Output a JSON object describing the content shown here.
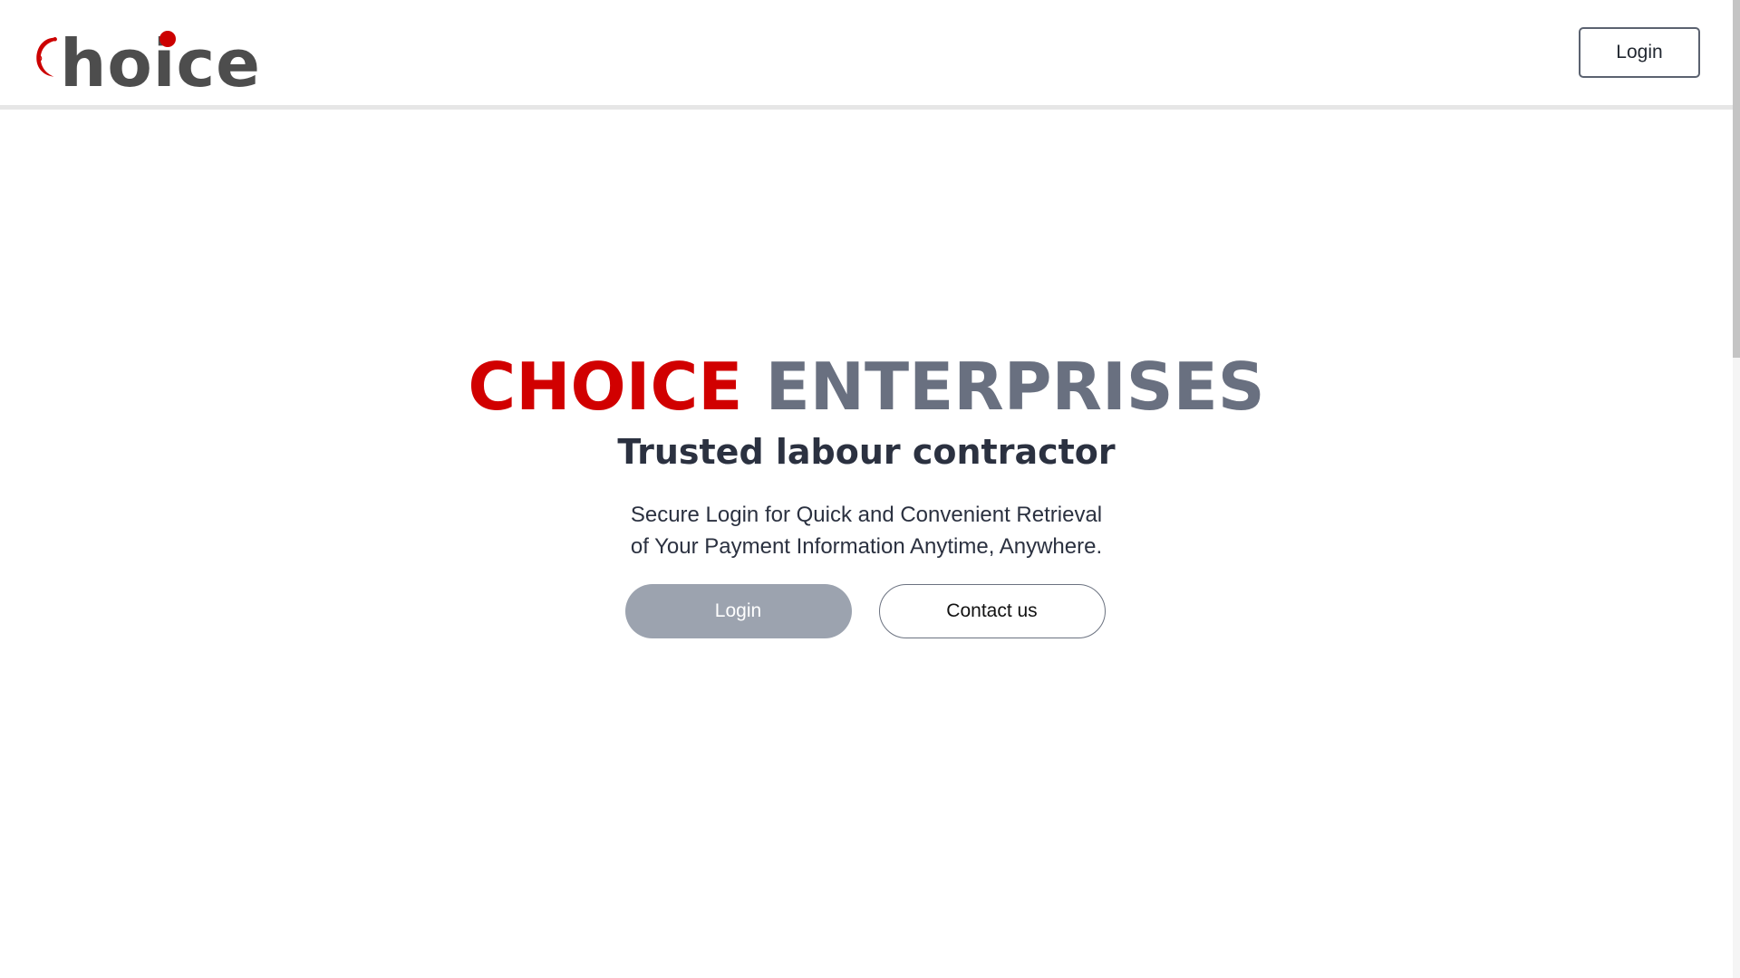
{
  "header": {
    "logo_text": "hoice",
    "logo_wordmark": "Choice",
    "login_label": "Login"
  },
  "hero": {
    "title_part1": "CHOICE",
    "title_part2": "ENTERPRISES",
    "subtitle": "Trusted labour contractor",
    "description_line1": "Secure Login for Quick and Convenient Retrieval",
    "description_line2": "of Your Payment Information Anytime, Anywhere.",
    "login_label": "Login",
    "contact_label": "Contact us"
  },
  "colors": {
    "brand_red": "#d10000",
    "brand_gray": "#697080",
    "logo_gray": "#4d4d4d",
    "primary_button": "#9ca3af",
    "text_dark": "#2b3140"
  },
  "icons": {
    "logo_mark": "crescent-c-logo-icon"
  }
}
